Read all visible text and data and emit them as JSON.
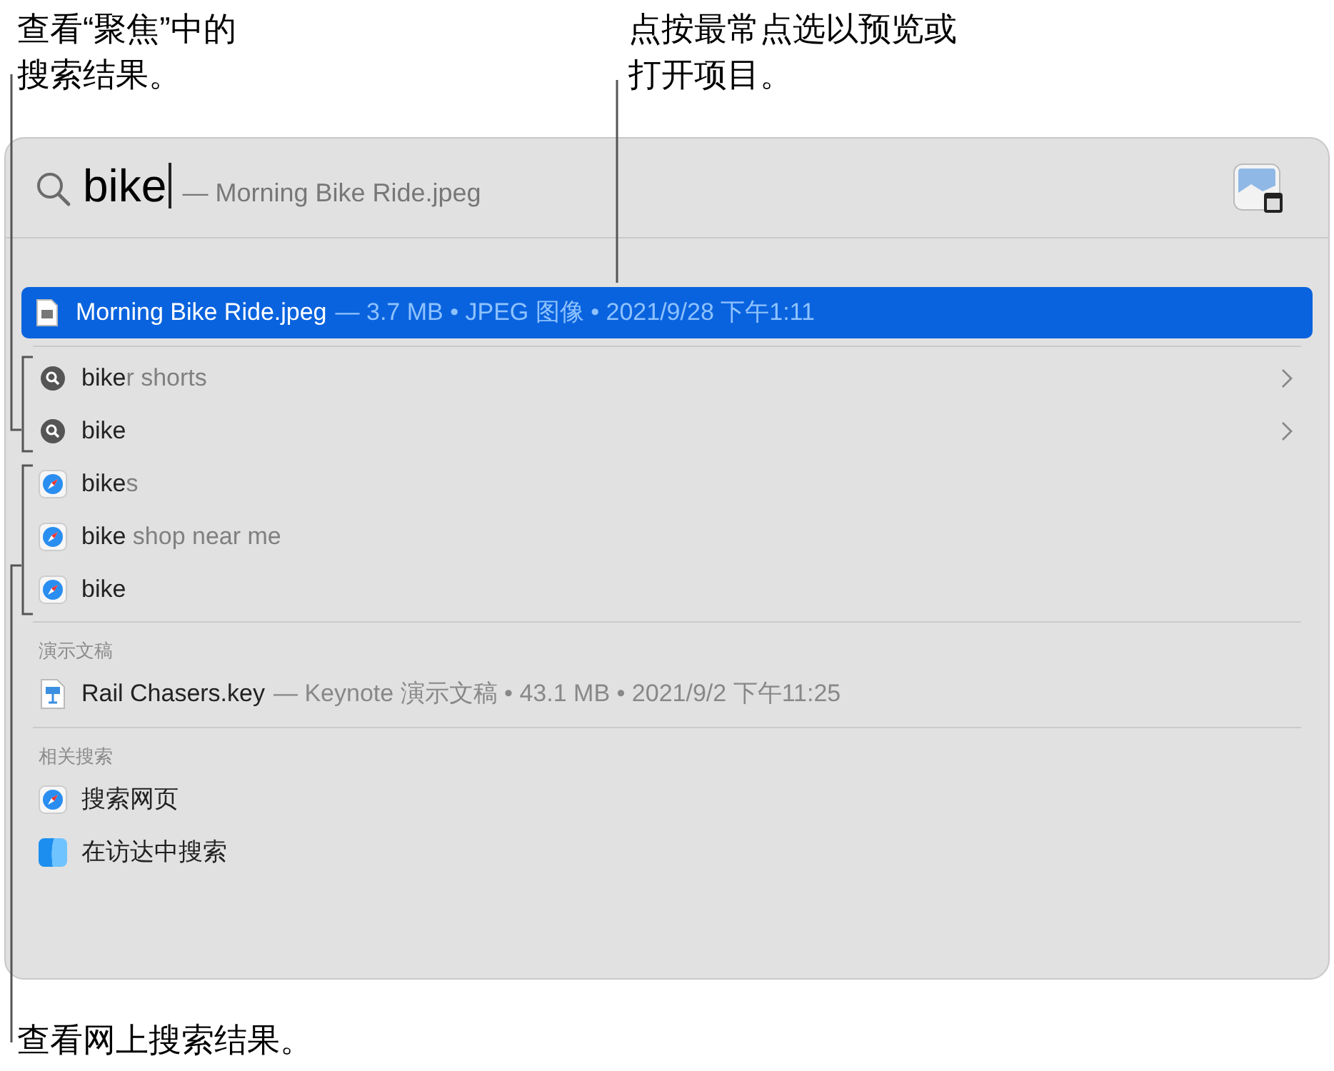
{
  "callouts": {
    "top_left": {
      "lines": [
        "查看“聚焦”中的",
        "搜索结果。"
      ]
    },
    "top_right": {
      "lines": [
        "点按最常点选以预览或",
        "打开项目。"
      ]
    },
    "bottom_left": {
      "lines": [
        "查看网上搜索结果。"
      ]
    }
  },
  "search": {
    "query": "bike",
    "completion": "— Morning Bike Ride.jpeg"
  },
  "top_hit": {
    "name": "Morning Bike Ride.jpeg",
    "detail": "— 3.7 MB • JPEG 图像 • 2021/9/28 下午1:11",
    "selected": true
  },
  "suggestions": [
    {
      "kind": "search",
      "typed": "bike",
      "completion": "r shorts"
    },
    {
      "kind": "search",
      "typed": "bike"
    },
    {
      "kind": "web",
      "typed": "bike",
      "completion": "s"
    },
    {
      "kind": "web",
      "typed": "bike",
      "completion": " shop near me"
    },
    {
      "kind": "web",
      "typed": "bike"
    }
  ],
  "sections": [
    {
      "header": "演示文稿",
      "items": [
        {
          "kind": "keynote",
          "name": "Rail Chasers.key",
          "detail": "— Keynote 演示文稿 • 43.1 MB • 2021/9/2 下午11:25"
        }
      ]
    },
    {
      "header": "相关搜索",
      "items": [
        {
          "kind": "web",
          "name": "搜索网页"
        },
        {
          "kind": "finder",
          "name": "在访达中搜索"
        }
      ]
    }
  ]
}
